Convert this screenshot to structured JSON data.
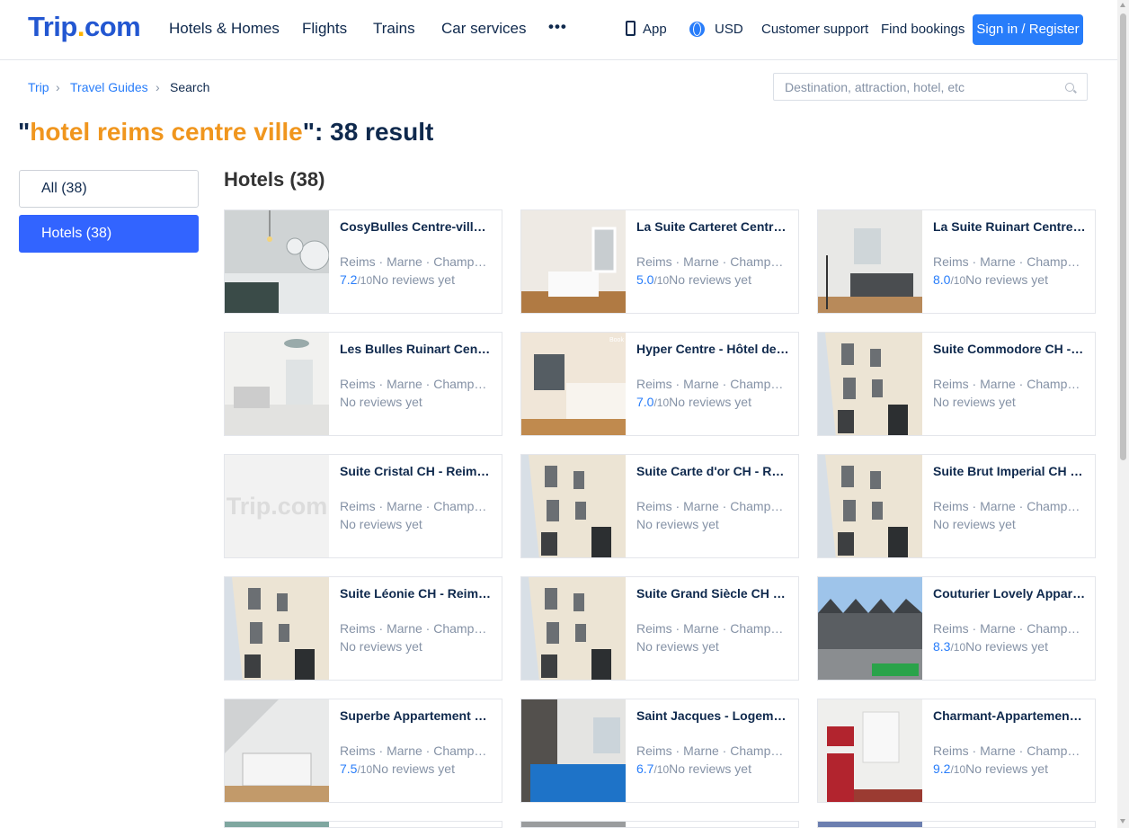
{
  "header": {
    "logo": {
      "main": "Trip",
      "dot": ".",
      "suffix": "com"
    },
    "nav": [
      "Hotels & Homes",
      "Flights",
      "Trains",
      "Car services"
    ],
    "more": "•••",
    "app_label": "App",
    "currency": "USD",
    "support": "Customer support",
    "bookings": "Find bookings",
    "signin": "Sign in / Register"
  },
  "breadcrumb": {
    "items": [
      "Trip",
      "Travel Guides",
      "Search"
    ],
    "separator": "›"
  },
  "search": {
    "placeholder": "Destination, attraction, hotel, etc"
  },
  "results": {
    "open_quote": "\"",
    "query": "hotel reims centre ville",
    "close_quote": "\"",
    "suffix": ": 38 result"
  },
  "filters": [
    {
      "label": "All (38)",
      "active": false
    },
    {
      "label": "Hotels (38)",
      "active": true
    }
  ],
  "section_title": "Hotels (38)",
  "location_text": "Reims · Marne · Champagne-Ardenne",
  "no_reviews": "No reviews yet",
  "out_of": "/10",
  "hotels": [
    {
      "name": "CosyBulles Centre-ville Reims",
      "score": "7.2",
      "thumb": "bedroom-lights"
    },
    {
      "name": "La Suite Carteret Centre Reims",
      "score": "5.0",
      "thumb": "bedroom-window"
    },
    {
      "name": "La Suite Ruinart Centre Reims",
      "score": "8.0",
      "thumb": "living-room"
    },
    {
      "name": "Les Bulles Ruinart Centre Reims",
      "score": "",
      "thumb": "bright-room"
    },
    {
      "name": "Hyper Centre - Hôtel de Ville",
      "score": "7.0",
      "thumb": "bedroom-warm"
    },
    {
      "name": "Suite Commodore CH - Reims",
      "score": "",
      "thumb": "building"
    },
    {
      "name": "Suite Cristal CH - Reims Centre",
      "score": "",
      "thumb": "placeholder"
    },
    {
      "name": "Suite Carte d'or CH - Reims",
      "score": "",
      "thumb": "building"
    },
    {
      "name": "Suite Brut Imperial CH - Reims",
      "score": "",
      "thumb": "building"
    },
    {
      "name": "Suite Léonie CH - Reims Centre",
      "score": "",
      "thumb": "building"
    },
    {
      "name": "Suite Grand Siècle CH - Reims",
      "score": "",
      "thumb": "building"
    },
    {
      "name": "Couturier Lovely Appartement",
      "score": "8.3",
      "thumb": "street"
    },
    {
      "name": "Superbe Appartement Centre",
      "score": "7.5",
      "thumb": "attic"
    },
    {
      "name": "Saint Jacques - Logement Centre",
      "score": "6.7",
      "thumb": "blue-bed"
    },
    {
      "name": "Charmant-Appartement Reims",
      "score": "9.2",
      "thumb": "kitchen"
    }
  ],
  "thumb_placeholder_text": "Trip.com",
  "colors": {
    "brand": "#287dfa",
    "query": "#f0961e",
    "active_filter": "#3264ff"
  }
}
